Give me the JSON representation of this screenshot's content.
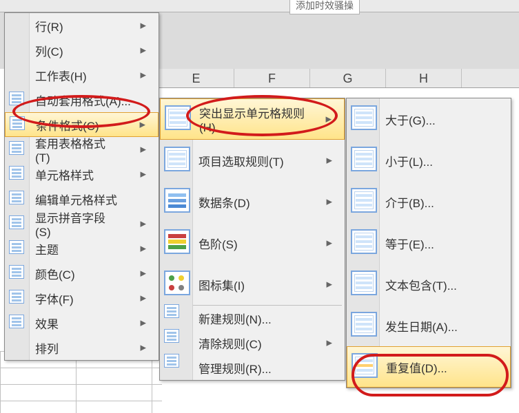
{
  "top_snippet": "添加时效骚操",
  "columns": [
    "E",
    "F",
    "G",
    "H"
  ],
  "menu1": {
    "items": [
      {
        "label": "行(R)",
        "has_sub": true,
        "icon": ""
      },
      {
        "label": "列(C)",
        "has_sub": true,
        "icon": ""
      },
      {
        "label": "工作表(H)",
        "has_sub": true,
        "icon": ""
      },
      {
        "label": "自动套用格式(A)...",
        "icon": "autoform"
      },
      {
        "label": "条件格式(C)",
        "has_sub": true,
        "icon": "condfmt",
        "hl": true
      },
      {
        "label": "套用表格格式(T)",
        "has_sub": true,
        "icon": "tablefmt"
      },
      {
        "label": "单元格样式",
        "has_sub": true,
        "icon": "cellstyle"
      },
      {
        "label": "编辑单元格样式",
        "icon": "editstyle"
      },
      {
        "label": "显示拼音字段(S)",
        "has_sub": true,
        "icon": "pinyin"
      },
      {
        "label": "主题",
        "has_sub": true,
        "icon": "theme"
      },
      {
        "label": "颜色(C)",
        "has_sub": true,
        "icon": "color"
      },
      {
        "label": "字体(F)",
        "has_sub": true,
        "icon": "font"
      },
      {
        "label": "效果",
        "has_sub": true,
        "icon": "effect"
      },
      {
        "label": "排列",
        "has_sub": true,
        "icon": ""
      }
    ]
  },
  "menu2": {
    "group1": [
      {
        "label": "突出显示单元格规则(H)",
        "icon": "hl",
        "hl": true,
        "has_sub": true
      },
      {
        "label": "项目选取规则(T)",
        "icon": "hl",
        "has_sub": true
      },
      {
        "label": "数据条(D)",
        "icon": "bars",
        "has_sub": true
      },
      {
        "label": "色阶(S)",
        "icon": "scale",
        "has_sub": true
      },
      {
        "label": "图标集(I)",
        "icon": "iconset",
        "has_sub": true
      }
    ],
    "group2": [
      {
        "label": "新建规则(N)..."
      },
      {
        "label": "清除规则(C)",
        "has_sub": true
      },
      {
        "label": "管理规则(R)..."
      }
    ]
  },
  "menu3": {
    "items": [
      {
        "label": "大于(G)...",
        "icon": "hl"
      },
      {
        "label": "小于(L)...",
        "icon": "hl"
      },
      {
        "label": "介于(B)...",
        "icon": "hl"
      },
      {
        "label": "等于(E)...",
        "icon": "hl"
      },
      {
        "label": "文本包含(T)...",
        "icon": "hl"
      },
      {
        "label": "发生日期(A)...",
        "icon": "hl"
      },
      {
        "label": "重复值(D)...",
        "icon": "hl-sel",
        "hl": true
      }
    ]
  }
}
